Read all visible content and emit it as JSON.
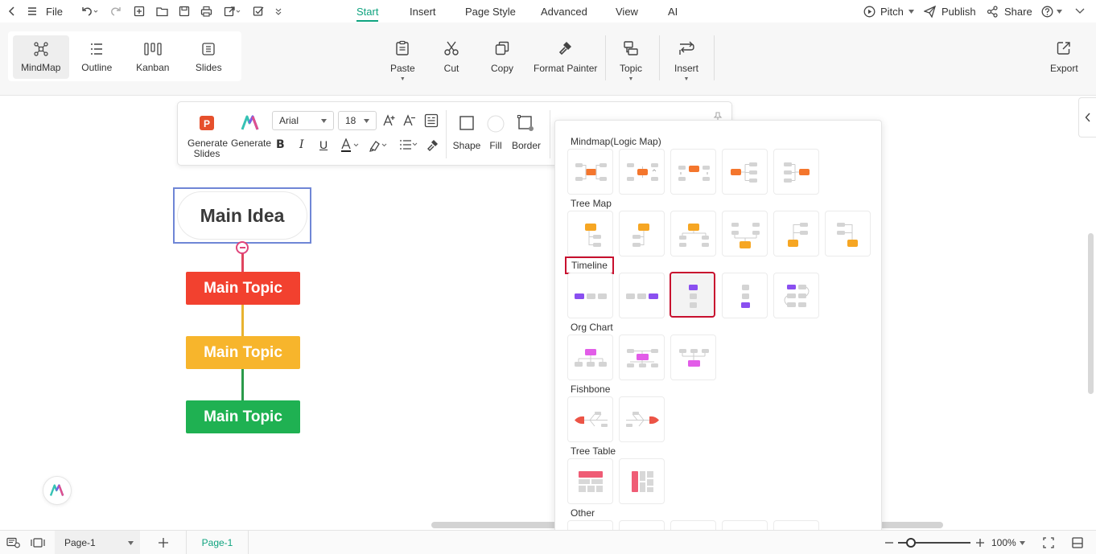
{
  "menubar": {
    "file_label": "File",
    "tabs": [
      {
        "label": "Start",
        "active": true
      },
      {
        "label": "Insert"
      },
      {
        "label": "Page Style"
      },
      {
        "label": "Advanced"
      },
      {
        "label": "View"
      },
      {
        "label": "AI"
      }
    ],
    "pitch_label": "Pitch",
    "publish_label": "Publish",
    "share_label": "Share"
  },
  "ribbon": {
    "views": [
      {
        "label": "MindMap",
        "icon": "mindmap-icon",
        "active": true
      },
      {
        "label": "Outline",
        "icon": "outline-icon"
      },
      {
        "label": "Kanban",
        "icon": "kanban-icon"
      },
      {
        "label": "Slides",
        "icon": "slides-icon"
      }
    ],
    "paste_label": "Paste",
    "cut_label": "Cut",
    "copy_label": "Copy",
    "format_painter_label": "Format Painter",
    "topic_label": "Topic",
    "insert_label": "Insert",
    "export_label": "Export"
  },
  "floating_toolbar": {
    "generate_slides_line1": "Generate",
    "generate_slides_line2": "Slides",
    "generate_label": "Generate",
    "font_family": "Arial",
    "font_size": "18",
    "shape_label": "Shape",
    "fill_label": "Fill",
    "border_label": "Border"
  },
  "mindmap": {
    "main_idea": "Main Idea",
    "topics": [
      {
        "label": "Main Topic",
        "color": "#f2412f"
      },
      {
        "label": "Main Topic",
        "color": "#f7b52c"
      },
      {
        "label": "Main Topic",
        "color": "#1fb152"
      }
    ]
  },
  "layout_panel": {
    "sections": [
      {
        "title": "Mindmap(Logic Map)"
      },
      {
        "title": "Tree Map"
      },
      {
        "title": "Timeline",
        "highlighted": true
      },
      {
        "title": "Org Chart"
      },
      {
        "title": "Fishbone"
      },
      {
        "title": "Tree Table"
      },
      {
        "title": "Other"
      }
    ]
  },
  "statusbar": {
    "page_select": "Page-1",
    "page_tab": "Page-1",
    "zoom": "100%"
  },
  "colors": {
    "accent": "#0fa37f",
    "highlight_red": "#c8102e",
    "selection_blue": "#6f86d6"
  }
}
